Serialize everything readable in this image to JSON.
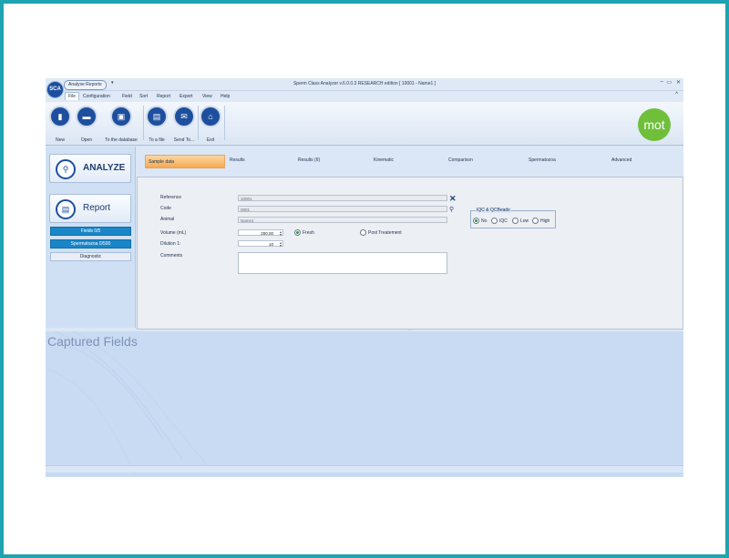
{
  "title_bar": {
    "logo_text": "SCA",
    "quick_access": "Analyse Reports",
    "qa_arrow": "▾",
    "window_title": "Sperm Class Analyzer v.6.0.0.3 RESEARCH edition [ 10001 - Name1 ]",
    "minimize": "–",
    "maximize": "▭",
    "close": "✕"
  },
  "menu": {
    "items": [
      "File",
      "Configuration",
      "Field",
      "Sort",
      "Report",
      "Export",
      "View",
      "Help"
    ],
    "collapse": "^"
  },
  "ribbon": {
    "buttons": [
      {
        "label": "New",
        "icon": "new-document-icon",
        "glyph": "▮"
      },
      {
        "label": "Open",
        "icon": "folder-icon",
        "glyph": "▬"
      },
      {
        "label": "To the database",
        "icon": "save-icon",
        "glyph": "▣"
      },
      {
        "label": "To a file",
        "icon": "export-file-icon",
        "glyph": "▤"
      },
      {
        "label": "Send To...",
        "icon": "mail-icon",
        "glyph": "✉"
      },
      {
        "label": "Exit",
        "icon": "home-icon",
        "glyph": "⌂"
      }
    ],
    "brand": "mot"
  },
  "sidebar": {
    "analyze_label": "ANALYZE",
    "report_label": "Report",
    "fields_status": "Fields 0/5",
    "spermatozoa_status": "Spermatozoa 0/500",
    "diagnostic_label": "Diagnostic"
  },
  "tabs": [
    "Sample data",
    "Results",
    "Results (II)",
    "Kinematic",
    "Comparison",
    "Spermatozoa",
    "Advanced"
  ],
  "form": {
    "reference_label": "Reference",
    "reference_value": "10001",
    "code_label": "Code",
    "code_value": "0001",
    "animal_label": "Animal",
    "animal_value": "Name1",
    "volume_label": "Volume (mL)",
    "volume_value": "200.00",
    "dilution_label": "Dilution 1:",
    "dilution_value": "10",
    "comments_label": "Comments",
    "comments_value": "",
    "sample_type": {
      "fresh": "Fresh",
      "post": "Post Treatement",
      "selected": "Fresh"
    },
    "iqc": {
      "legend": "IQC & QCBeads",
      "options": [
        "No",
        "IQC",
        "Low",
        "High"
      ],
      "selected": "No"
    }
  },
  "splitter_grip": "·····",
  "bottom": {
    "title": "Captured Fields"
  },
  "colors": {
    "frame": "#1fa3b0",
    "ribbon_icon": "#1d4f9e",
    "status_blue": "#1a86c8",
    "active_tab": "#f6a94f",
    "brand_green": "#6fbf3b"
  }
}
